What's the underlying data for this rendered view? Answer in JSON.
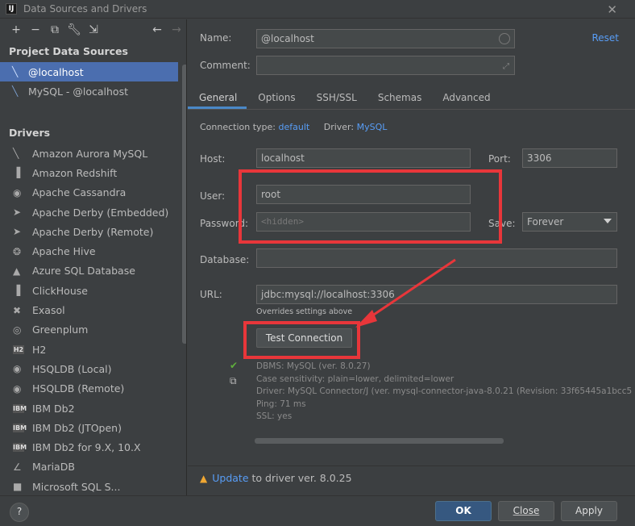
{
  "window": {
    "title": "Data Sources and Drivers",
    "app_icon": "IJ"
  },
  "toolbar": {
    "icons": [
      "add-icon",
      "remove-icon",
      "duplicate-icon",
      "wrench-icon",
      "import-icon",
      "back-icon",
      "forward-icon"
    ]
  },
  "left": {
    "project_title": "Project Data Sources",
    "data_sources": [
      {
        "label": "@localhost",
        "selected": true
      },
      {
        "label": "MySQL - @localhost",
        "selected": false
      }
    ],
    "drivers_title": "Drivers",
    "drivers": [
      {
        "label": "Amazon Aurora MySQL",
        "icon": "aurora-icon",
        "glyph": "╲"
      },
      {
        "label": "Amazon Redshift",
        "icon": "redshift-icon",
        "glyph": "▐"
      },
      {
        "label": "Apache Cassandra",
        "icon": "cassandra-icon",
        "glyph": "◉"
      },
      {
        "label": "Apache Derby (Embedded)",
        "icon": "derby-icon",
        "glyph": "➤"
      },
      {
        "label": "Apache Derby (Remote)",
        "icon": "derby-icon",
        "glyph": "➤"
      },
      {
        "label": "Apache Hive",
        "icon": "hive-icon",
        "glyph": "❂"
      },
      {
        "label": "Azure SQL Database",
        "icon": "azure-icon",
        "glyph": "▲"
      },
      {
        "label": "ClickHouse",
        "icon": "clickhouse-icon",
        "glyph": "▐"
      },
      {
        "label": "Exasol",
        "icon": "exasol-icon",
        "glyph": "✖"
      },
      {
        "label": "Greenplum",
        "icon": "greenplum-icon",
        "glyph": "◎"
      },
      {
        "label": "H2",
        "icon": "h2-icon",
        "glyph": "H2"
      },
      {
        "label": "HSQLDB (Local)",
        "icon": "hsqldb-icon",
        "glyph": "◉"
      },
      {
        "label": "HSQLDB (Remote)",
        "icon": "hsqldb-icon",
        "glyph": "◉"
      },
      {
        "label": "IBM Db2",
        "icon": "ibm-db2-icon",
        "glyph": "IBM"
      },
      {
        "label": "IBM Db2 (JTOpen)",
        "icon": "ibm-db2-icon",
        "glyph": "IBM"
      },
      {
        "label": "IBM Db2 for 9.X, 10.X",
        "icon": "ibm-db2-icon",
        "glyph": "IBM"
      },
      {
        "label": "MariaDB",
        "icon": "mariadb-icon",
        "glyph": "∠"
      },
      {
        "label": "Microsoft SQL S...",
        "icon": "mssql-icon",
        "glyph": "■"
      }
    ]
  },
  "form": {
    "name_label": "Name:",
    "name_value": "@localhost",
    "reset_label": "Reset",
    "comment_label": "Comment:",
    "comment_value": "",
    "tabs": [
      {
        "label": "General",
        "active": true
      },
      {
        "label": "Options",
        "active": false
      },
      {
        "label": "SSH/SSL",
        "active": false
      },
      {
        "label": "Schemas",
        "active": false
      },
      {
        "label": "Advanced",
        "active": false
      }
    ],
    "connection_type_label": "Connection type:",
    "connection_type_value": "default",
    "driver_label": "Driver:",
    "driver_value": "MySQL",
    "host_label": "Host:",
    "host_value": "localhost",
    "port_label": "Port:",
    "port_value": "3306",
    "user_label": "User:",
    "user_value": "root",
    "password_label": "Password:",
    "password_placeholder": "<hidden>",
    "save_label": "Save:",
    "save_value": "Forever",
    "database_label": "Database:",
    "database_value": "",
    "url_label": "URL:",
    "url_value": "jdbc:mysql://localhost:3306",
    "url_note": "Overrides settings above",
    "test_connection_label": "Test Connection",
    "result_lines": [
      "DBMS: MySQL (ver. 8.0.27)",
      "Case sensitivity: plain=lower, delimited=lower",
      "Driver: MySQL Connector/J (ver. mysql-connector-java-8.0.21 (Revision: 33f65445a1bcc5",
      "Ping: 71 ms",
      "SSL: yes"
    ],
    "update_link": "Update",
    "update_text": " to driver ver. 8.0.25"
  },
  "buttons": {
    "help": "?",
    "ok": "OK",
    "close": "Close",
    "apply": "Apply"
  },
  "colors": {
    "accent": "#4b6eaf",
    "link": "#589df6",
    "annotation": "#e8363a",
    "success": "#5fae3d",
    "warning": "#f0a732"
  }
}
